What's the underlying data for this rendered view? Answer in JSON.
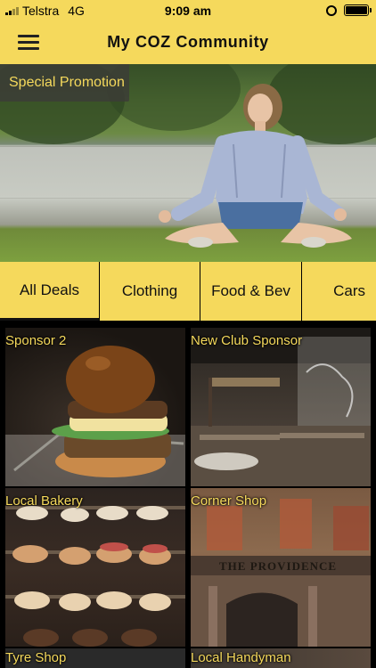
{
  "status_bar": {
    "carrier": "Telstra",
    "network": "4G",
    "time": "9:09 am",
    "icons": [
      "signal-icon",
      "alarm-icon",
      "battery-icon"
    ]
  },
  "nav": {
    "title": "My COZ Community",
    "menu_icon": "hamburger-menu-icon"
  },
  "hero": {
    "promo_label": "Special Promotion"
  },
  "tabs": [
    {
      "label": "All Deals",
      "active": true
    },
    {
      "label": "Clothing",
      "active": false
    },
    {
      "label": "Food & Bev",
      "active": false
    },
    {
      "label": "Cars",
      "active": false
    }
  ],
  "deals": [
    {
      "label": "Sponsor 2"
    },
    {
      "label": "New Club Sponsor"
    },
    {
      "label": "Local Bakery"
    },
    {
      "label": "Corner Shop"
    },
    {
      "label": "Tyre Shop"
    },
    {
      "label": "Local Handyman"
    }
  ],
  "colors": {
    "accent": "#f5d95c",
    "background": "#000000"
  }
}
